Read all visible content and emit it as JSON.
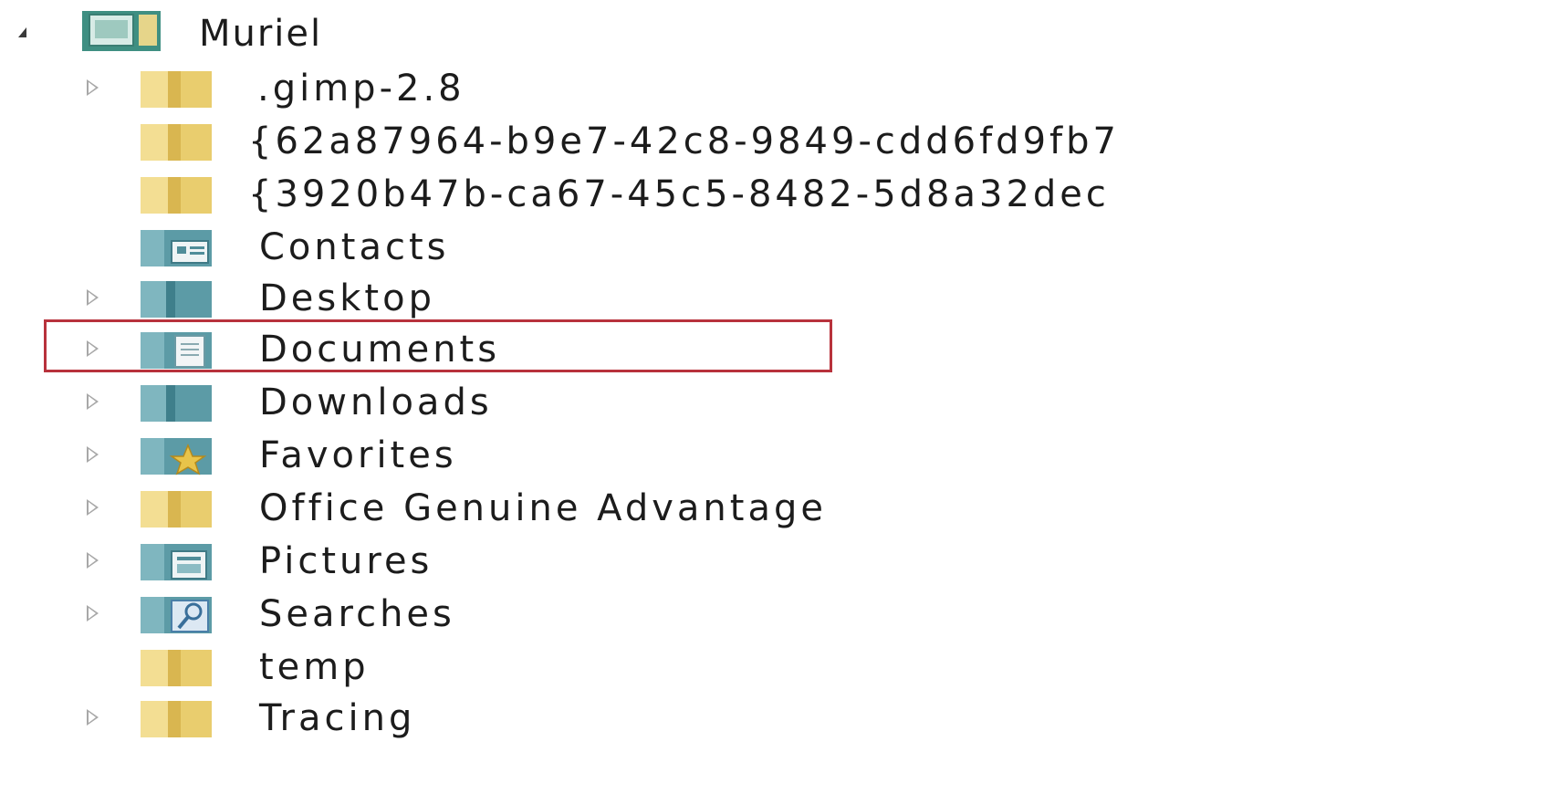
{
  "tree": {
    "root": {
      "label": "Muriel",
      "icon": "user-folder-icon",
      "expanded": true
    },
    "items": [
      {
        "label": ".gimp-2.8",
        "icon": "folder-icon",
        "has_children": true
      },
      {
        "label": "{62a87964-b9e7-42c8-9849-cdd6fd9fb7",
        "icon": "folder-icon",
        "has_children": false
      },
      {
        "label": "{3920b47b-ca67-45c5-8482-5d8a32dec",
        "icon": "folder-icon",
        "has_children": false
      },
      {
        "label": "Contacts",
        "icon": "contacts-folder-icon",
        "has_children": false
      },
      {
        "label": "Desktop",
        "icon": "desktop-folder-icon",
        "has_children": true
      },
      {
        "label": "Documents",
        "icon": "documents-folder-icon",
        "has_children": true,
        "highlighted": true
      },
      {
        "label": "Downloads",
        "icon": "downloads-folder-icon",
        "has_children": true
      },
      {
        "label": "Favorites",
        "icon": "favorites-folder-icon",
        "has_children": true
      },
      {
        "label": "Office Genuine Advantage",
        "icon": "folder-icon",
        "has_children": true
      },
      {
        "label": "Pictures",
        "icon": "pictures-folder-icon",
        "has_children": true
      },
      {
        "label": "Searches",
        "icon": "searches-folder-icon",
        "has_children": true
      },
      {
        "label": "temp",
        "icon": "folder-icon",
        "has_children": false
      },
      {
        "label": "Tracing",
        "icon": "folder-icon",
        "has_children": true
      }
    ]
  },
  "colors": {
    "highlight_border": "#b8323c",
    "folder_yellow": "#e8c867",
    "special_folder_teal": "#5b9aa8"
  }
}
